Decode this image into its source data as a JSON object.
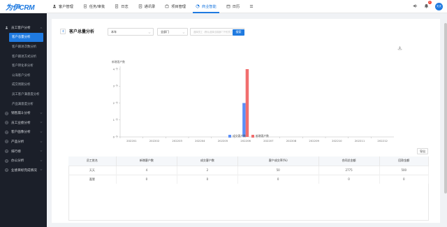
{
  "app": {
    "logo": "为伊CRM"
  },
  "nav": [
    {
      "label": "客户管理",
      "icon": "user-icon"
    },
    {
      "label": "任务/审批",
      "icon": "task-icon"
    },
    {
      "label": "日志",
      "icon": "log-icon"
    },
    {
      "label": "通讯录",
      "icon": "contacts-icon"
    },
    {
      "label": "项目管理",
      "icon": "project-icon"
    },
    {
      "label": "商业智能",
      "icon": "bi-icon",
      "active": true
    },
    {
      "label": "日历",
      "icon": "calendar-icon"
    },
    {
      "label": "",
      "icon": "grid-icon"
    }
  ],
  "topright": {
    "notification_count": "2",
    "user_initials": "天天"
  },
  "sidebar": {
    "groups": [
      {
        "label": "员工客户分析",
        "icon": "person-icon",
        "expanded": true,
        "items": [
          "客户总量分析",
          "客户跟进次数分析",
          "客户跟进方式分析",
          "客户转化率分析",
          "公海客户分析",
          "成交周期分析",
          "员工客户满意度分析",
          "产品满意度分析"
        ]
      },
      {
        "label": "销售漏斗分析",
        "icon": "funnel-icon"
      },
      {
        "label": "员工业绩分析",
        "icon": "chart-icon"
      },
      {
        "label": "客户画像分析",
        "icon": "portrait-icon"
      },
      {
        "label": "产品分析",
        "icon": "product-icon"
      },
      {
        "label": "排行榜",
        "icon": "rank-icon"
      },
      {
        "label": "办公分析",
        "icon": "office-icon"
      },
      {
        "label": "业绩目标完成情况",
        "icon": "target-icon"
      }
    ],
    "active_item": "客户总量分析"
  },
  "header": {
    "title": "客户总量分析"
  },
  "filters": {
    "period": "本年",
    "department": "全部门",
    "employee_placeholder": "选择员工（默认选择当前部门下的员工）",
    "search_label": "搜索"
  },
  "chart_data": {
    "type": "bar",
    "ylabel": "新增客户数",
    "categories": [
      "202201",
      "202202",
      "202203",
      "202204",
      "202205",
      "202206",
      "202207",
      "202208",
      "202209",
      "202210",
      "202211",
      "202212"
    ],
    "series": [
      {
        "name": "成交客户数",
        "color": "#5b8ff9",
        "values": [
          0,
          0,
          0,
          0,
          0,
          2,
          0,
          0,
          0,
          0,
          0,
          0
        ]
      },
      {
        "name": "新增客户数",
        "color": "#f16e6e",
        "values": [
          0,
          0,
          0,
          0,
          0,
          4,
          0,
          0,
          0,
          0,
          0,
          0
        ]
      }
    ],
    "yticks": [
      "0 个",
      "1 个",
      "2 个",
      "3 个",
      "4 个"
    ],
    "ylim": [
      0,
      4
    ],
    "legend": "bottom",
    "grid": false
  },
  "table": {
    "export_label": "导出",
    "columns": [
      "员工姓名",
      "新增客户数",
      "成交客户数",
      "客户成交率(%)",
      "合同总金额",
      "回款金额"
    ],
    "rows": [
      [
        "天天",
        "4",
        "2",
        "50",
        "2775",
        "500"
      ],
      [
        "嘉慧",
        "0",
        "0",
        "0",
        "0",
        "0"
      ]
    ]
  }
}
